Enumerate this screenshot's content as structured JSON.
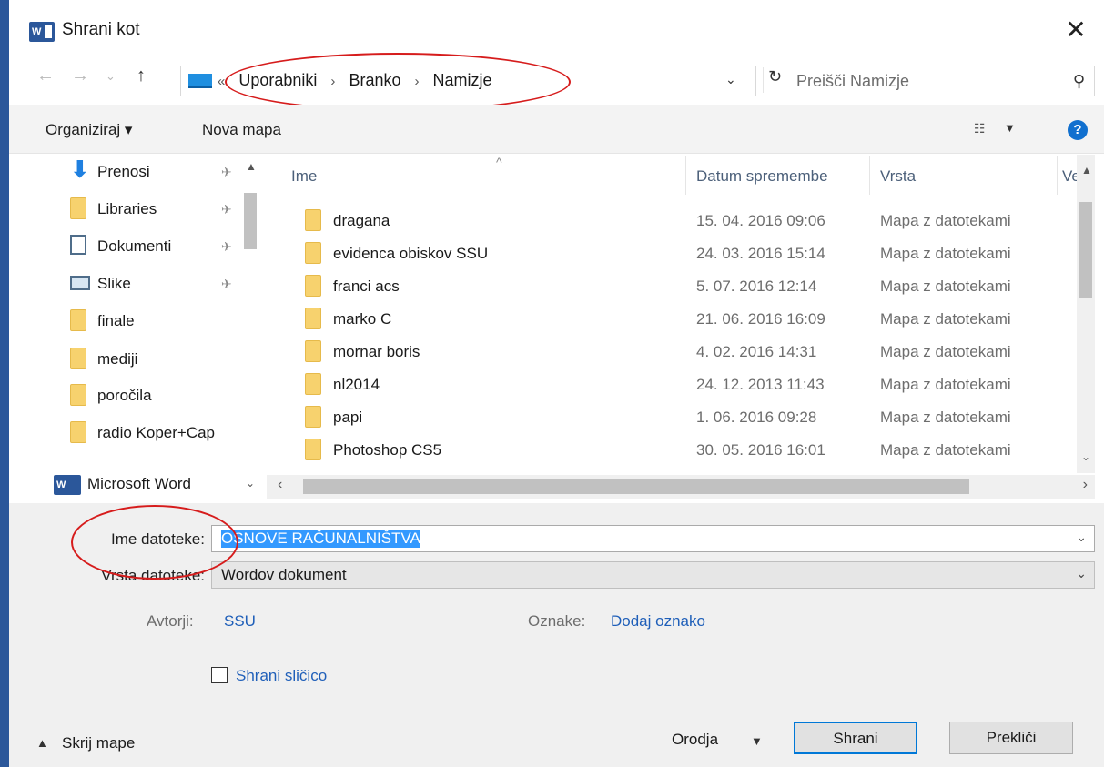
{
  "title": "Shrani kot",
  "breadcrumb": [
    "Uporabniki",
    "Branko",
    "Namizje"
  ],
  "search": {
    "placeholder": "Preišči Namizje"
  },
  "toolbar": {
    "organize": "Organiziraj ▾",
    "new_folder": "Nova mapa"
  },
  "nav_pane": {
    "items": [
      {
        "label": "Prenosi",
        "icon": "download-arrow-icon",
        "pinned": true
      },
      {
        "label": "Libraries",
        "icon": "folder-icon",
        "pinned": true
      },
      {
        "label": "Dokumenti",
        "icon": "document-icon",
        "pinned": true
      },
      {
        "label": "Slike",
        "icon": "pictures-icon",
        "pinned": true
      },
      {
        "label": "finale",
        "icon": "folder-icon",
        "pinned": false
      },
      {
        "label": "mediji",
        "icon": "folder-icon",
        "pinned": false
      },
      {
        "label": "poročila",
        "icon": "folder-icon",
        "pinned": false
      },
      {
        "label": "radio Koper+Cap",
        "icon": "folder-icon",
        "pinned": false
      }
    ],
    "app_item": "Microsoft Word"
  },
  "file_list": {
    "columns": [
      "Ime",
      "Datum spremembe",
      "Vrsta",
      "Ve"
    ],
    "rows": [
      {
        "name": "dragana",
        "date": "15. 04. 2016 09:06",
        "type": "Mapa z datotekami"
      },
      {
        "name": "evidenca obiskov SSU",
        "date": "24. 03. 2016 15:14",
        "type": "Mapa z datotekami"
      },
      {
        "name": "franci acs",
        "date": "5. 07. 2016 12:14",
        "type": "Mapa z datotekami"
      },
      {
        "name": "marko C",
        "date": "21. 06. 2016 16:09",
        "type": "Mapa z datotekami"
      },
      {
        "name": "mornar boris",
        "date": "4. 02. 2016 14:31",
        "type": "Mapa z datotekami"
      },
      {
        "name": "nl2014",
        "date": "24. 12. 2013 11:43",
        "type": "Mapa z datotekami"
      },
      {
        "name": "papi",
        "date": "1. 06. 2016 09:28",
        "type": "Mapa z datotekami"
      },
      {
        "name": "Photoshop CS5",
        "date": "30. 05. 2016 16:01",
        "type": "Mapa z datotekami"
      }
    ]
  },
  "form": {
    "filename_label": "Ime datoteke:",
    "filename_value": "OSNOVE RAČUNALNIŠTVA",
    "filetype_label": "Vrsta datoteke:",
    "filetype_value": "Wordov dokument",
    "authors_label": "Avtorji:",
    "authors_value": "SSU",
    "tags_label": "Oznake:",
    "tags_value": "Dodaj oznako",
    "thumbnail_label": "Shrani sličico"
  },
  "footer": {
    "hide_folders": "Skrij mape",
    "tools": "Orodja",
    "save": "Shrani",
    "cancel": "Prekliči"
  },
  "colors": {
    "accent": "#2b579a",
    "annotation": "#d61c1c",
    "selection": "#3399ff"
  }
}
